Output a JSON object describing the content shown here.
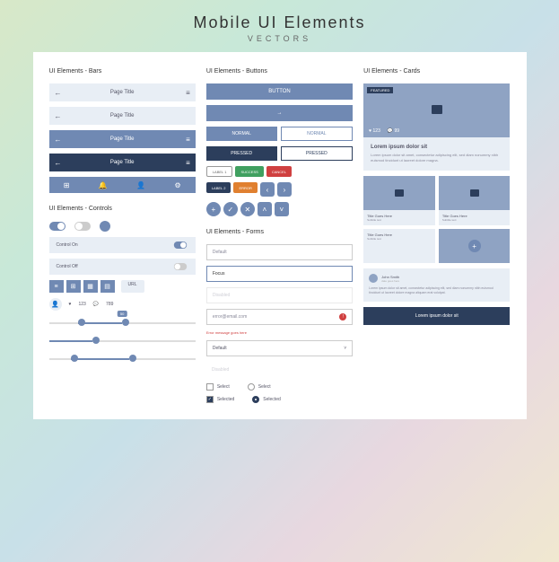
{
  "header": {
    "title": "Mobile UI Elements",
    "subtitle": "VECTORS"
  },
  "sections": {
    "bars": "UI Elements - Bars",
    "buttons": "UI Elements - Buttons",
    "cards": "UI Elements - Cards",
    "controls": "UI Elements - Controls",
    "forms": "UI Elements - Forms"
  },
  "bars": {
    "page_title": "Page Title",
    "back": "←",
    "menu": "≡"
  },
  "buttons": {
    "button": "BUTTON",
    "arrow": "→",
    "normal": "NORMAL",
    "pressed": "PRESSED",
    "chips": {
      "label1": "LABEL 1",
      "label2": "LABEL 2",
      "success": "SUCCESS",
      "cancel": "CANCEL",
      "error": "ERROR"
    }
  },
  "cards": {
    "featured": "FEATURED",
    "likes": "123",
    "comments": "99",
    "title": "Lorem ipsum dolor sit",
    "body": "Lorem ipsum dolor sit amet, consectetur adipiscing elit, sed diam nonummy nibh euismod tincidunt ut laoreet dolore magna.",
    "mini_title": "Title Goes Here",
    "mini_sub": "Subtitle text",
    "user": "John Smith",
    "date": "date goes here",
    "comment": "Lorem ipsum dolor sit amet, consectetur adipiscing elit, sed diam nonummy nibh euismod tincidunt ut laoreet dolore magna aliquam erat volutpat.",
    "footer": "Lorem ipsum dolor sit"
  },
  "controls": {
    "on": "Control On",
    "off": "Control Off",
    "url": "URL",
    "likes": "123",
    "views": "789",
    "slider_val": "50"
  },
  "forms": {
    "default": "Default",
    "focus": "Focus",
    "disabled": "Disabled",
    "email": "error@email.com",
    "error": "Error message goes here",
    "select": "Select",
    "selected": "Selected"
  }
}
